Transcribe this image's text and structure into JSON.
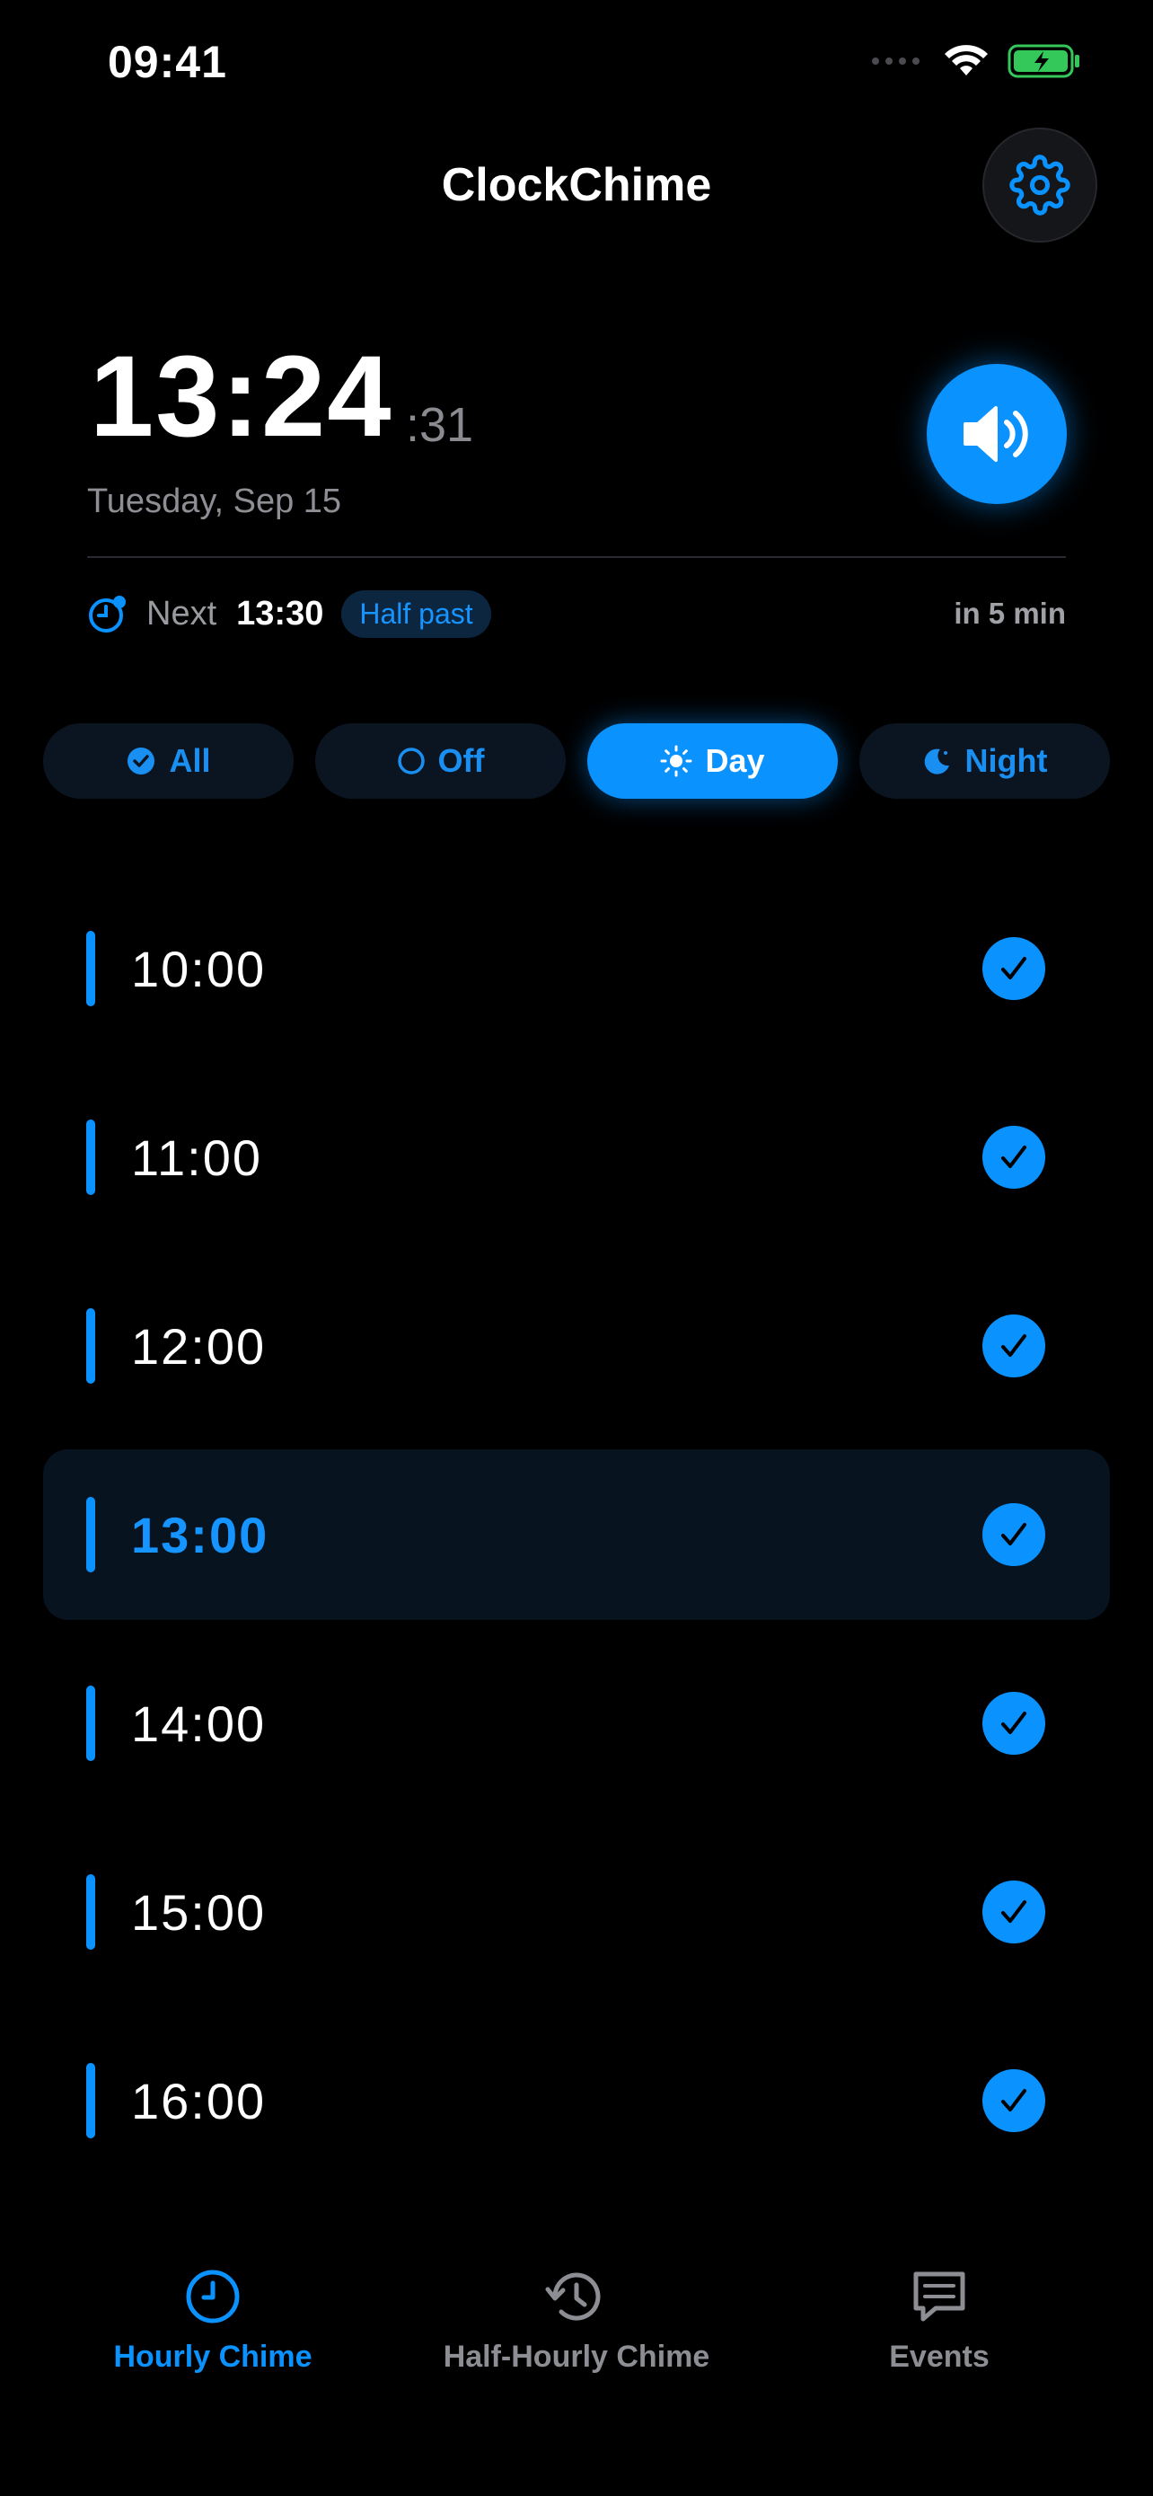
{
  "status_bar": {
    "time": "09:41"
  },
  "header": {
    "title": "ClockChime"
  },
  "clock": {
    "time": "13:24",
    "seconds": ":31",
    "date": "Tuesday, Sep 15"
  },
  "next": {
    "label": "Next",
    "time": "13:30",
    "badge": "Half past",
    "countdown": "in 5 min"
  },
  "filters": [
    {
      "label": "All",
      "icon": "check-circle-icon",
      "active": false
    },
    {
      "label": "Off",
      "icon": "circle-icon",
      "active": false
    },
    {
      "label": "Day",
      "icon": "sun-icon",
      "active": true
    },
    {
      "label": "Night",
      "icon": "moon-icon",
      "active": false
    }
  ],
  "chimes": [
    {
      "time": "10:00",
      "enabled": true
    },
    {
      "time": "11:00",
      "enabled": true
    },
    {
      "time": "12:00",
      "enabled": true
    },
    {
      "time": "13:00",
      "enabled": true,
      "current": true
    },
    {
      "time": "14:00",
      "enabled": true
    },
    {
      "time": "15:00",
      "enabled": true
    },
    {
      "time": "16:00",
      "enabled": true
    }
  ],
  "tabs": [
    {
      "label": "Hourly Chime",
      "icon": "clock-icon",
      "active": true
    },
    {
      "label": "Half-Hourly Chime",
      "icon": "history-icon",
      "active": false
    },
    {
      "label": "Events",
      "icon": "message-icon",
      "active": false
    }
  ],
  "colors": {
    "accent": "#0a92ff",
    "background": "#000000",
    "battery": "#34c759"
  }
}
